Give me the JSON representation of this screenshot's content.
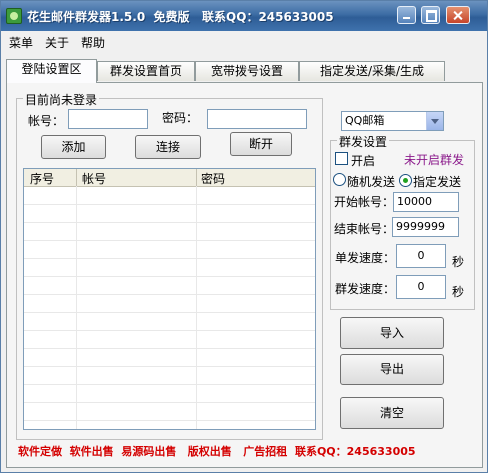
{
  "window": {
    "title": "花生邮件群发器1.5.0  免费版   联系QQ：245633005"
  },
  "menu": [
    "菜单",
    "关于",
    "帮助"
  ],
  "tabs": [
    "登陆设置区",
    "群发设置首页",
    "宽带拨号设置",
    "指定发送/采集/生成"
  ],
  "login": {
    "status_title": "目前尚未登录",
    "account_label": "帐号：",
    "password_label": "密码：",
    "account_value": "",
    "password_value": "",
    "add_button": "添加",
    "connect_button": "连接",
    "disconnect_button": "断开",
    "mail_type": "QQ邮箱"
  },
  "table": {
    "columns": [
      "序号",
      "帐号",
      "密码"
    ],
    "rows": []
  },
  "group_send": {
    "title": "群发设置",
    "enable_label": "开启",
    "enable_checked": false,
    "status": "未开启群发",
    "status_color": "#8b1a8b",
    "random_label": "随机发送",
    "specified_label": "指定发送",
    "selected_mode": "指定发送",
    "start_label": "开始帐号：",
    "start_value": "10000",
    "end_label": "结束帐号：",
    "end_value": "9999999",
    "single_speed_label": "单发速度：",
    "single_speed_value": "0",
    "group_speed_label": "群发速度：",
    "group_speed_value": "0",
    "seconds_unit": "秒"
  },
  "actions": {
    "import_button": "导入",
    "export_button": "导出",
    "clear_button": "清空"
  },
  "footer": {
    "text": "软件定做  软件出售  易源码出售   版权出售   广告招租  联系QQ：245633005",
    "color": "#d40000"
  }
}
